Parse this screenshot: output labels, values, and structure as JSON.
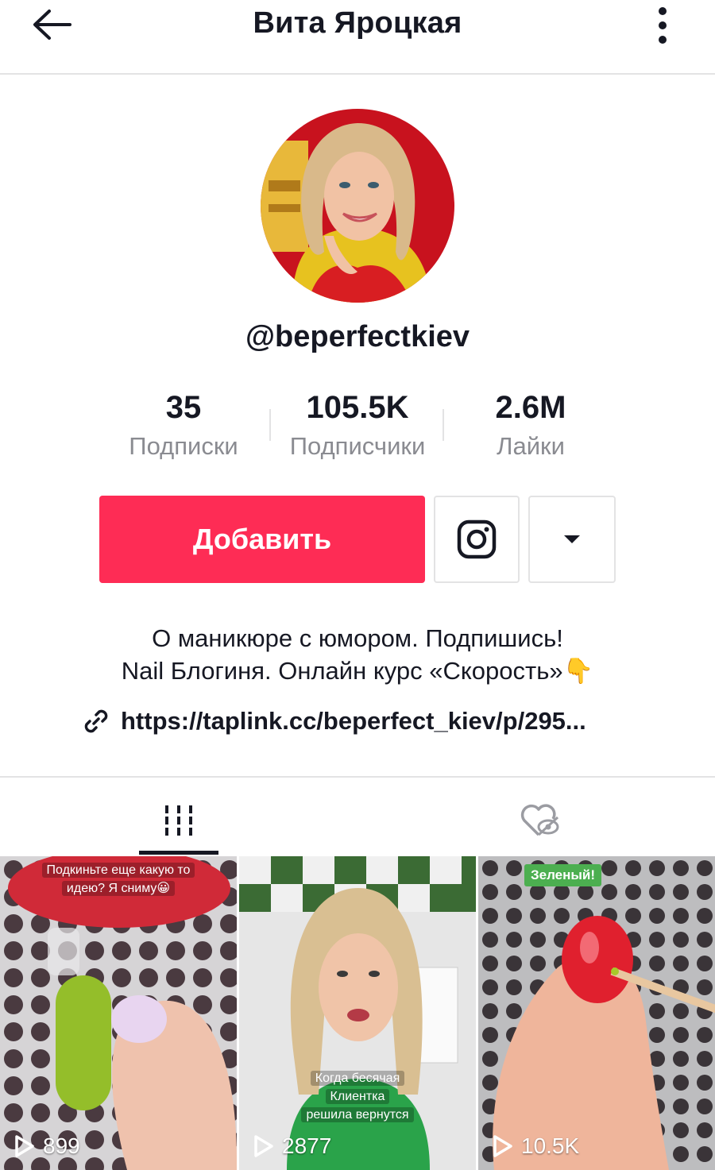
{
  "header": {
    "title": "Вита Яроцкая",
    "back_icon": "arrow-left-icon",
    "more_icon": "more-vertical-icon"
  },
  "profile": {
    "username": "@beperfectkiev"
  },
  "stats": [
    {
      "value": "35",
      "label": "Подписки"
    },
    {
      "value": "105.5K",
      "label": "Подписчики"
    },
    {
      "value": "2.6M",
      "label": "Лайки"
    }
  ],
  "actions": {
    "follow_label": "Добавить",
    "instagram_icon": "instagram-icon",
    "dropdown_icon": "caret-down-icon"
  },
  "bio": {
    "line1": "О маникюре с юмором. Подпишись!",
    "line2": "Nail Блогиня.  Онлайн курс «Скорость»👇",
    "link": "https://taplink.cc/beperfect_kiev/p/295..."
  },
  "tabs": {
    "videos_icon": "grid-icon",
    "liked_icon": "heart-hidden-icon"
  },
  "videos": [
    {
      "views": "899",
      "caption_lines": [
        "Подкиньте еще какую то",
        "идею? Я сниму😀"
      ]
    },
    {
      "views": "2877",
      "caption_lines": [
        "Когда бесячая",
        "Клиентка",
        "решила вернутся"
      ]
    },
    {
      "views": "10.5K",
      "badge": "Зеленый!"
    }
  ],
  "colors": {
    "accent": "#fe2c55",
    "text": "#161823",
    "muted": "#8a8b91",
    "divider": "#e3e3e4"
  }
}
